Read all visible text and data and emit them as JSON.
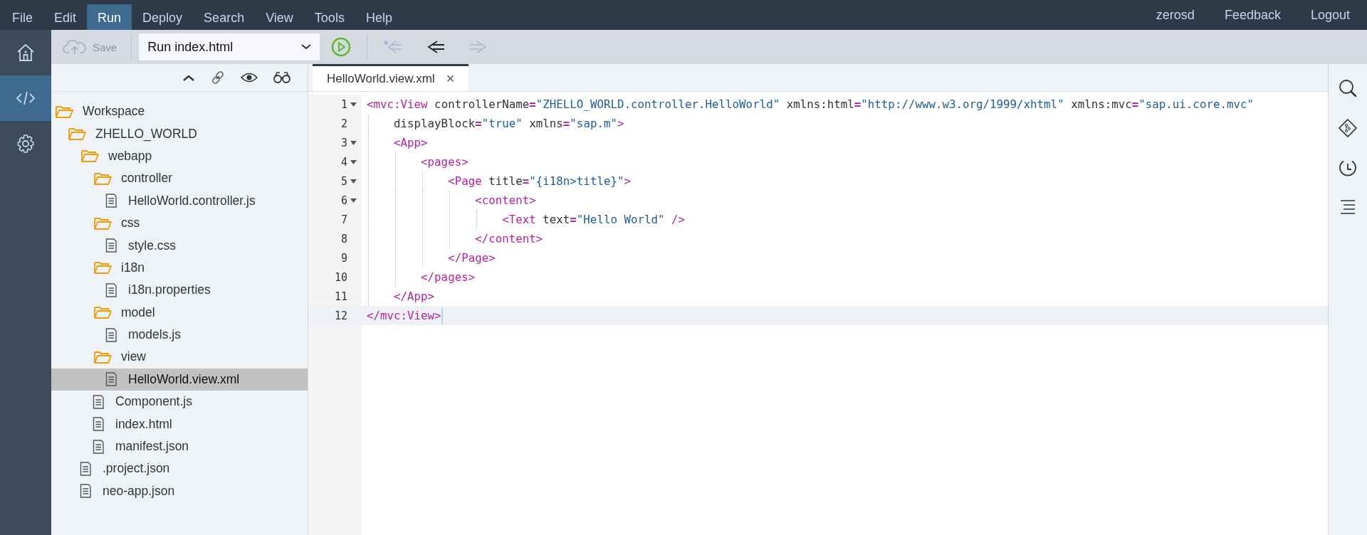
{
  "menu_bar": {
    "items": [
      {
        "label": "File",
        "selected": false
      },
      {
        "label": "Edit",
        "selected": false
      },
      {
        "label": "Run",
        "selected": true
      },
      {
        "label": "Deploy",
        "selected": false
      },
      {
        "label": "Search",
        "selected": false
      },
      {
        "label": "View",
        "selected": false
      },
      {
        "label": "Tools",
        "selected": false
      },
      {
        "label": "Help",
        "selected": false
      }
    ],
    "user": "zerosd",
    "links": [
      "Feedback",
      "Logout"
    ]
  },
  "left_rail": {
    "items": [
      {
        "selected": false
      },
      {
        "selected": true
      },
      {
        "selected": false
      }
    ]
  },
  "toolbar": {
    "save": {
      "label": "Save",
      "disabled": true
    },
    "run_config": {
      "value": "Run index.html"
    },
    "nav_buttons": [
      {
        "disabled": true
      },
      {
        "disabled": false
      },
      {
        "disabled": true
      }
    ]
  },
  "workspace_tree": [
    {
      "label": "Workspace",
      "kind": "folder",
      "expanded": true,
      "selected": false,
      "children": [
        {
          "label": "ZHELLO_WORLD",
          "kind": "folder",
          "expanded": true,
          "selected": false,
          "children": [
            {
              "label": "webapp",
              "kind": "folder",
              "expanded": true,
              "selected": false,
              "children": [
                {
                  "label": "controller",
                  "kind": "folder",
                  "expanded": true,
                  "selected": false,
                  "children": [
                    {
                      "label": "HelloWorld.controller.js",
                      "kind": "file",
                      "selected": false
                    }
                  ]
                },
                {
                  "label": "css",
                  "kind": "folder",
                  "expanded": true,
                  "selected": false,
                  "children": [
                    {
                      "label": "style.css",
                      "kind": "file",
                      "selected": false
                    }
                  ]
                },
                {
                  "label": "i18n",
                  "kind": "folder",
                  "expanded": true,
                  "selected": false,
                  "children": [
                    {
                      "label": "i18n.properties",
                      "kind": "file",
                      "selected": false
                    }
                  ]
                },
                {
                  "label": "model",
                  "kind": "folder",
                  "expanded": true,
                  "selected": false,
                  "children": [
                    {
                      "label": "models.js",
                      "kind": "file",
                      "selected": false
                    }
                  ]
                },
                {
                  "label": "view",
                  "kind": "folder",
                  "expanded": true,
                  "selected": false,
                  "children": [
                    {
                      "label": "HelloWorld.view.xml",
                      "kind": "file",
                      "selected": true
                    }
                  ]
                },
                {
                  "label": "Component.js",
                  "kind": "file",
                  "selected": false
                },
                {
                  "label": "index.html",
                  "kind": "file",
                  "selected": false
                },
                {
                  "label": "manifest.json",
                  "kind": "file",
                  "selected": false
                }
              ]
            },
            {
              "label": ".project.json",
              "kind": "file",
              "selected": false
            },
            {
              "label": "neo-app.json",
              "kind": "file",
              "selected": false
            }
          ]
        }
      ]
    }
  ],
  "editor": {
    "tabs": [
      {
        "label": "HelloWorld.view.xml",
        "selected": true,
        "close": "×"
      }
    ],
    "lines": [
      {
        "number": "1",
        "foldable": true,
        "active": false,
        "tokens": [
          {
            "kind": "tag",
            "text": "<mvc:View"
          },
          {
            "kind": "attr",
            "text": " controllerName"
          },
          {
            "kind": "eq",
            "text": "="
          },
          {
            "kind": "str",
            "text": "\"ZHELLO_WORLD.controller.HelloWorld\""
          },
          {
            "kind": "attr",
            "text": " xmlns:html"
          },
          {
            "kind": "eq",
            "text": "="
          },
          {
            "kind": "str",
            "text": "\"http://www.w3.org/1999/xhtml\""
          },
          {
            "kind": "attr",
            "text": " xmlns:mvc"
          },
          {
            "kind": "eq",
            "text": "="
          },
          {
            "kind": "str",
            "text": "\"sap.ui.core.mvc\""
          }
        ]
      },
      {
        "number": "2",
        "foldable": false,
        "active": false,
        "tokens": [
          {
            "kind": "attr",
            "text": "    displayBlock"
          },
          {
            "kind": "eq",
            "text": "="
          },
          {
            "kind": "str",
            "text": "\"true\""
          },
          {
            "kind": "attr",
            "text": " xmlns"
          },
          {
            "kind": "eq",
            "text": "="
          },
          {
            "kind": "str",
            "text": "\"sap.m\""
          },
          {
            "kind": "tag",
            "text": ">"
          }
        ]
      },
      {
        "number": "3",
        "foldable": true,
        "active": false,
        "tokens": [
          {
            "kind": "tag",
            "text": "    <App>"
          }
        ]
      },
      {
        "number": "4",
        "foldable": true,
        "active": false,
        "tokens": [
          {
            "kind": "tag",
            "text": "        <pages>"
          }
        ]
      },
      {
        "number": "5",
        "foldable": true,
        "active": false,
        "tokens": [
          {
            "kind": "tag",
            "text": "            <Page"
          },
          {
            "kind": "attr",
            "text": " title"
          },
          {
            "kind": "eq",
            "text": "="
          },
          {
            "kind": "str",
            "text": "\"{i18n>title}\""
          },
          {
            "kind": "tag",
            "text": ">"
          }
        ]
      },
      {
        "number": "6",
        "foldable": true,
        "active": false,
        "tokens": [
          {
            "kind": "tag",
            "text": "                <content>"
          }
        ]
      },
      {
        "number": "7",
        "foldable": false,
        "active": false,
        "tokens": [
          {
            "kind": "tag",
            "text": "                    <Text"
          },
          {
            "kind": "attr",
            "text": " text"
          },
          {
            "kind": "eq",
            "text": "="
          },
          {
            "kind": "str",
            "text": "\"Hello World\""
          },
          {
            "kind": "tag",
            "text": " />"
          }
        ]
      },
      {
        "number": "8",
        "foldable": false,
        "active": false,
        "tokens": [
          {
            "kind": "tag",
            "text": "                </content>"
          }
        ]
      },
      {
        "number": "9",
        "foldable": false,
        "active": false,
        "tokens": [
          {
            "kind": "tag",
            "text": "            </Page>"
          }
        ]
      },
      {
        "number": "10",
        "foldable": false,
        "active": false,
        "tokens": [
          {
            "kind": "tag",
            "text": "        </pages>"
          }
        ]
      },
      {
        "number": "11",
        "foldable": false,
        "active": false,
        "tokens": [
          {
            "kind": "tag",
            "text": "    </App>"
          }
        ]
      },
      {
        "number": "12",
        "foldable": false,
        "active": true,
        "tokens": [
          {
            "kind": "tag",
            "text": "</mvc:View>"
          }
        ]
      }
    ]
  }
}
